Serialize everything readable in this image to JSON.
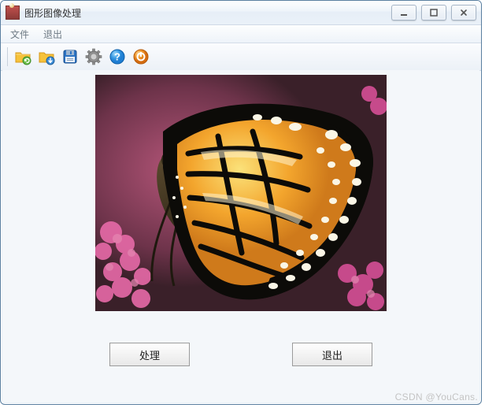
{
  "window": {
    "title": "图形图像处理"
  },
  "title_icons": {
    "minimize": "minimize-icon",
    "maximize": "maximize-icon",
    "close": "close-icon"
  },
  "menubar": {
    "items": [
      "文件",
      "退出"
    ]
  },
  "toolbar": {
    "icons": [
      "folder-refresh-icon",
      "folder-download-icon",
      "floppy-save-icon",
      "gear-icon",
      "help-icon",
      "power-icon"
    ],
    "colors": {
      "folder_base": "#f6c23a",
      "folder_shadow": "#d6991e",
      "refresh_badge": "#6cc04a",
      "download_badge": "#3c8dd8",
      "floppy": "#2d74c4",
      "floppy_metal": "#9fb6d0",
      "gear_outer": "#8f8f8f",
      "gear_inner": "#cfcfcf",
      "help_outer": "#1f7ed3",
      "help_mid": "#69bdf2",
      "power_outer": "#e57d1e",
      "power_mid": "#f7b75c"
    }
  },
  "buttons": {
    "process": "处理",
    "exit": "退出"
  },
  "watermark": "CSDN @YouCans."
}
